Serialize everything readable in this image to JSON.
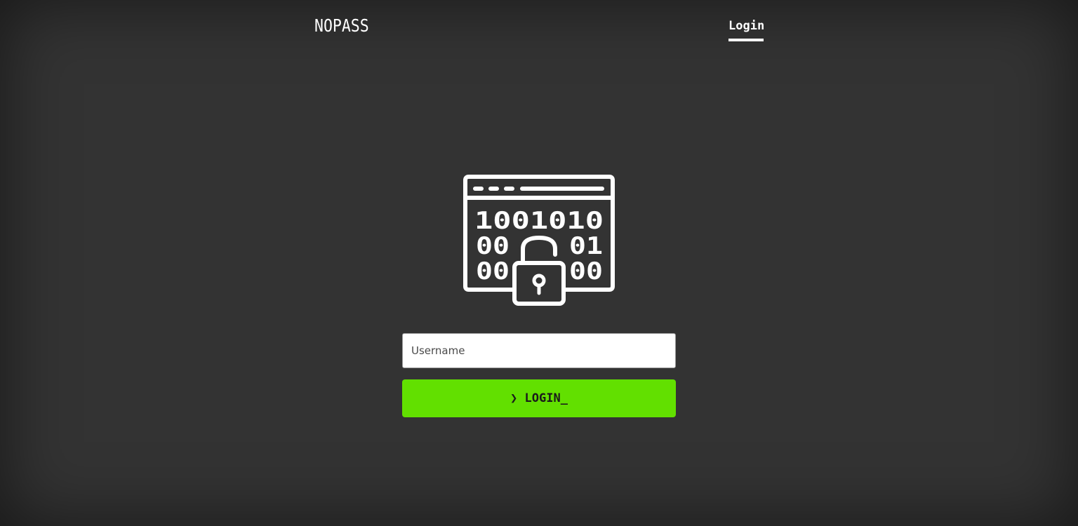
{
  "header": {
    "brand": "NOPASS",
    "nav_login": "Login"
  },
  "hero": {
    "icon": "binary-unlocked-padlock-icon",
    "binary_rows": [
      "1001010",
      "00",
      "01",
      "00",
      "00"
    ]
  },
  "form": {
    "username_placeholder": "Username",
    "username_value": "",
    "login_button_label": "❯ LOGIN_"
  },
  "colors": {
    "background": "#333333",
    "accent": "#62e000",
    "text": "#ffffff"
  }
}
